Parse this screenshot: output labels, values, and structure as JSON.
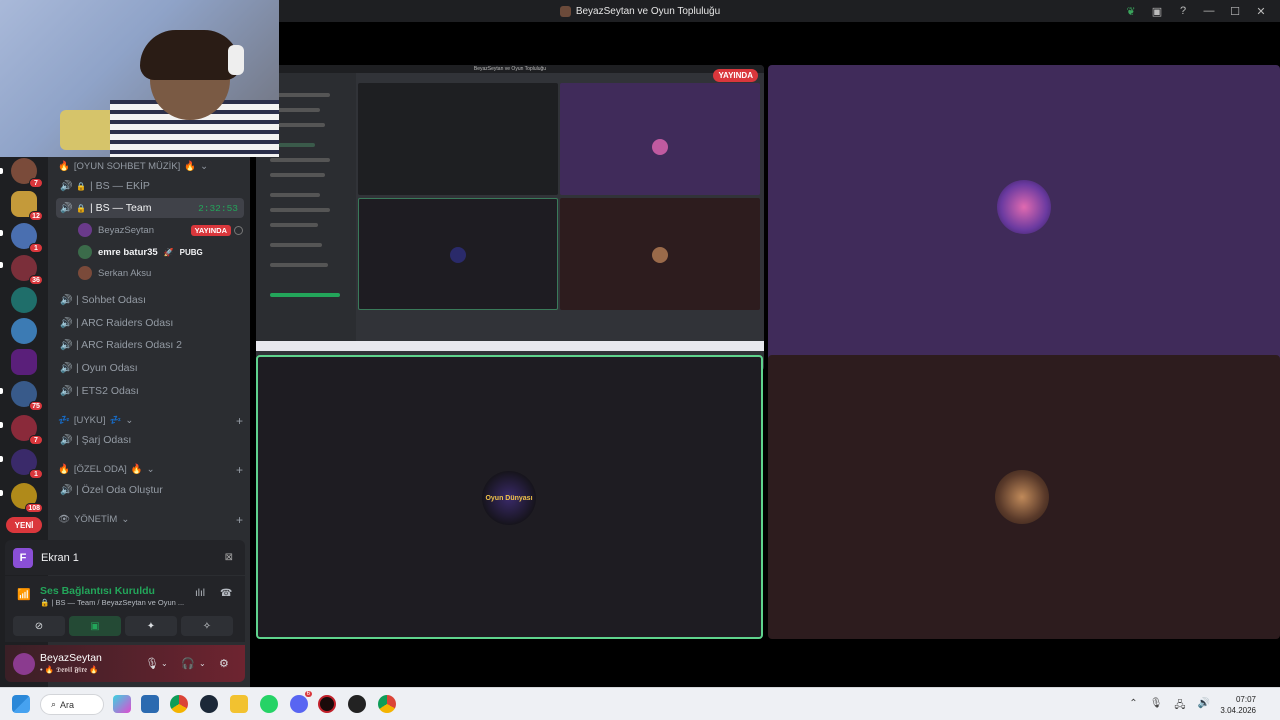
{
  "window": {
    "title": "BeyazSeytan ve Oyun Topluluğu",
    "controls": {
      "nitro_icon": "leaf-icon",
      "screen_icon": "screen-icon",
      "help_icon": "help-icon",
      "minimize": "—",
      "maximize": "☐",
      "close": "✕"
    }
  },
  "guilds": {
    "badges": [
      "7",
      "12",
      "1",
      "36",
      "75",
      "7",
      "1",
      "108"
    ],
    "new_label": "YENİ"
  },
  "sidebar": {
    "categories": {
      "oyun": "[OYUN SOHBET MÜZİK]",
      "uyku": "[UYKU]",
      "ozel": "[ÖZEL ODA]",
      "yonetim": "YÖNETİM"
    },
    "channels": {
      "ekip": "| BS — EKİP",
      "team": "| BS — Team",
      "team_timer": "2:32:53",
      "sohbet": "| Sohbet Odası",
      "arc1": "| ARC Raiders Odası",
      "arc2": "| ARC Raiders Odası 2",
      "oyun": "| Oyun Odası",
      "ets2": "| ETS2 Odası",
      "sarj": "| Şarj Odası",
      "ozel_olustur": "| Özel Oda Oluştur"
    },
    "members": [
      {
        "name": "BeyazSeytan",
        "badge": "YAYINDA"
      },
      {
        "name": "emre batur35",
        "activity": "PUBG"
      },
      {
        "name": "Serkan Aksu"
      }
    ]
  },
  "screen_panel": {
    "initial": "F",
    "label": "Ekran 1"
  },
  "voice": {
    "status": "Ses Bağlantısı Kuruldu",
    "sub": "🔒 | BS — Team / BeyazSeytan ve Oyun ..."
  },
  "user": {
    "name": "BeyazSeytan",
    "status": "• 🔥 𝕯𝖊𝖛𝖎𝖑 𝕱𝖎𝖗𝖊 🔥"
  },
  "stage": {
    "live_tag": "YAYINDA",
    "mini_title": "BeyazSeytan ve Oyun Topluluğu",
    "oyun_avatar_text": "Oyun Dünyası"
  },
  "taskbar": {
    "search": "Ara",
    "time": "07:07",
    "date": "3.04.2026",
    "discord_badge": "6"
  },
  "colors": {
    "accent_green": "#23a55a",
    "live_red": "#da373c",
    "bs_tile": "#402b5a",
    "serkan_tile": "#2d1c1e"
  }
}
